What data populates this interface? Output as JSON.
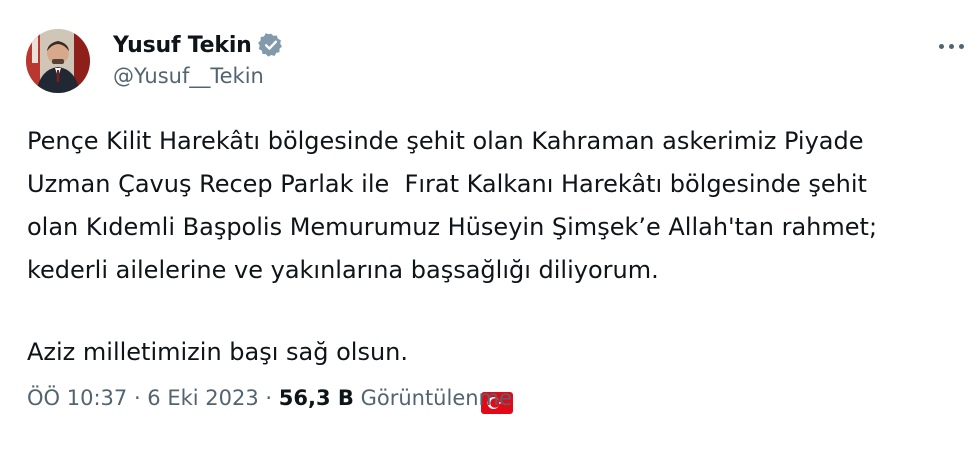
{
  "author": {
    "name": "Yusuf Tekin",
    "handle": "@Yusuf__Tekin",
    "avatar_icon": "profile-photo",
    "verified_icon": "verified-badge-icon"
  },
  "more_icon": "more-options-icon",
  "tweet": {
    "lines": [
      "Pençe Kilit Harekâtı bölgesinde şehit olan Kahraman askerimiz Piyade",
      "Uzman Çavuş Recep Parlak ile  Fırat Kalkanı Harekâtı bölgesinde şehit",
      "olan Kıdemli Başpolis Memurumuz Hüseyin Şimşek’e Allah'tan rahmet;",
      "kederli ailelerine ve yakınlarına başsağlığı diliyorum."
    ],
    "closing": "Aziz milletimizin başı sağ olsun.",
    "flag_icon": "turkey-flag-icon"
  },
  "meta": {
    "time": "ÖÖ 10:37",
    "separator": " · ",
    "date": "6 Eki 2023",
    "views_count": "56,3 B",
    "views_label": "Görüntülenme"
  },
  "colors": {
    "text": "#0f1419",
    "secondary": "#536471",
    "verified": "#829aab",
    "flag_red": "#e30a17"
  }
}
